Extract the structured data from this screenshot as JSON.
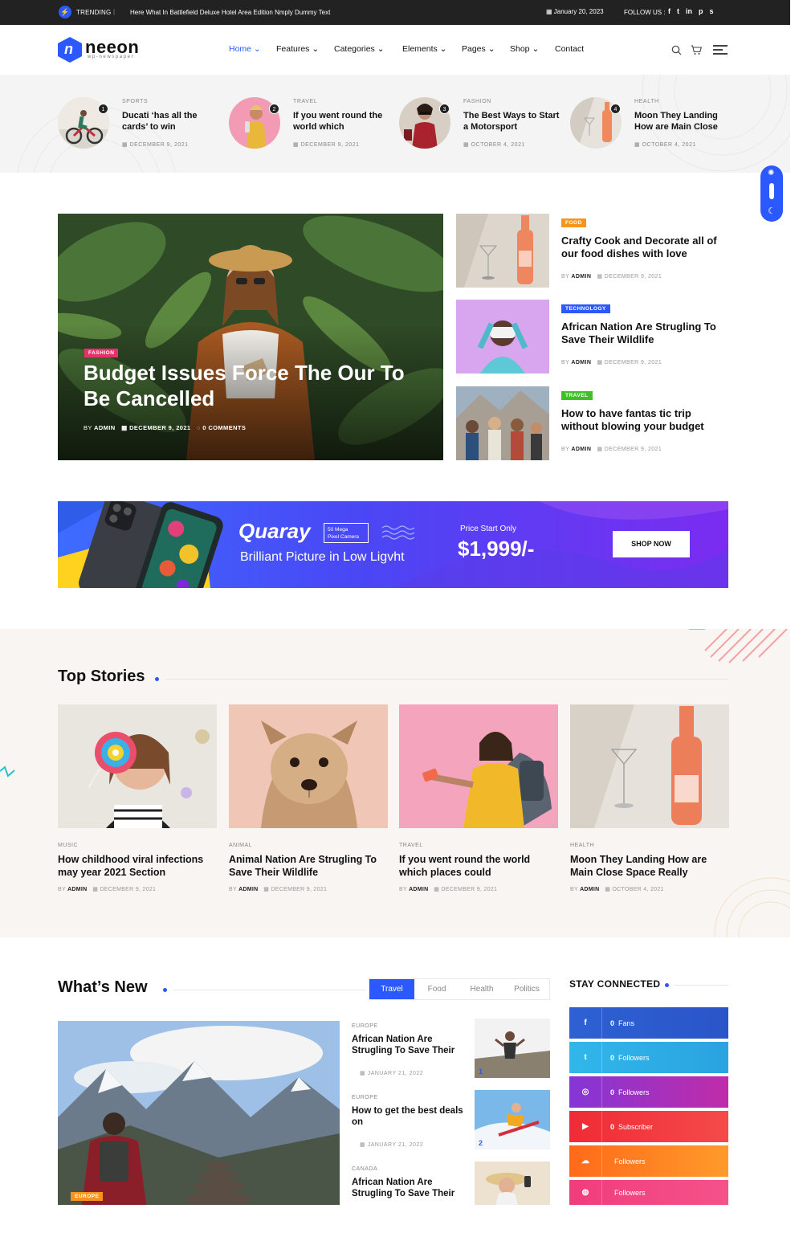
{
  "topbar": {
    "trending_label": "TRENDING",
    "separator": "|",
    "ticker_text": "Here What In Battlefield Deluxe Hotel Area Edition Nmply Dummy Text",
    "date": "January 20, 2023",
    "follow_label": "FOLLOW US :",
    "social_icons": [
      "facebook-icon",
      "twitter-icon",
      "linkedin-icon",
      "pinterest-icon",
      "skype-icon"
    ]
  },
  "brand": {
    "name": "neeon",
    "tagline": "wp-newspaper",
    "accent": "#2b59ff"
  },
  "nav": {
    "items": [
      {
        "label": "Home ⌄"
      },
      {
        "label": "Features ⌄"
      },
      {
        "label": "Categories ⌄"
      },
      {
        "label": "Elements ⌄"
      },
      {
        "label": "Pages ⌄"
      },
      {
        "label": "Shop ⌄"
      },
      {
        "label": "Contact"
      }
    ]
  },
  "trending": [
    {
      "num": "1",
      "category": "SPORTS",
      "title": "Ducati ‘has all the cards’ to win",
      "date": "DECEMBER 9, 2021"
    },
    {
      "num": "2",
      "category": "TRAVEL",
      "title": "If you went round the world which",
      "date": "DECEMBER 9, 2021"
    },
    {
      "num": "3",
      "category": "FASHION",
      "title": "The Best Ways to Start a Motorsport",
      "date": "OCTOBER 4, 2021"
    },
    {
      "num": "4",
      "category": "HEALTH",
      "title": "Moon They Landing How are Main Close",
      "date": "OCTOBER 4, 2021"
    }
  ],
  "hero": {
    "category": "FASHION",
    "title": "Budget Issues Force The Our To Be Cancelled",
    "by": "BY",
    "author": "ADMIN",
    "date": "DECEMBER 9, 2021",
    "comments": "0 COMMENTS"
  },
  "side_posts": [
    {
      "category": "FOOD",
      "color": "#f7941d",
      "title": "Crafty Cook and Decorate all of our food dishes with love",
      "by": "BY",
      "author": "ADMIN",
      "date": "DECEMBER 9, 2021"
    },
    {
      "category": "TECHNOLOGY",
      "color": "#2b59ff",
      "title": "African Nation Are Strugling To Save Their Wildlife",
      "by": "BY",
      "author": "ADMIN",
      "date": "DECEMBER 9, 2021"
    },
    {
      "category": "TRAVEL",
      "color": "#3ec126",
      "title": "How to have fantas tic trip without blowing your budget",
      "by": "BY",
      "author": "ADMIN",
      "date": "DECEMBER 9, 2021"
    }
  ],
  "banner": {
    "brand": "Quaray",
    "badge_line1": "50 Mega",
    "badge_line2": "Pixel Camera",
    "subtitle": "Brilliant Picture in Low Ligvht",
    "price_label": "Price Start Only",
    "price": "$1,999/-",
    "cta": "SHOP NOW"
  },
  "top_stories": {
    "heading": "Top Stories",
    "items": [
      {
        "category": "MUSIC",
        "title": "How childhood viral infections may year 2021 Section",
        "by": "BY",
        "author": "ADMIN",
        "date": "DECEMBER 9, 2021"
      },
      {
        "category": "ANIMAL",
        "title": "Animal Nation Are Strugling To Save Their Wildlife",
        "by": "BY",
        "author": "ADMIN",
        "date": "DECEMBER 9, 2021"
      },
      {
        "category": "TRAVEL",
        "title": "If you went round the world which places could",
        "by": "BY",
        "author": "ADMIN",
        "date": "DECEMBER 9, 2021"
      },
      {
        "category": "HEALTH",
        "title": "Moon They Landing How are Main Close Space Really",
        "by": "BY",
        "author": "ADMIN",
        "date": "OCTOBER 4, 2021"
      }
    ]
  },
  "whats_new": {
    "heading": "What’s New",
    "tabs": [
      "Travel",
      "Food",
      "Health",
      "Politics"
    ],
    "active_tab": "Travel",
    "featured_category": "EUROPE",
    "items": [
      {
        "category": "EUROPE",
        "title": "African Nation Are Strugling To Save Their",
        "date": "JANUARY 21, 2022",
        "num": "1"
      },
      {
        "category": "EUROPE",
        "title": "How to get the best deals on",
        "date": "JANUARY 21, 2022",
        "num": "2"
      },
      {
        "category": "CANADA",
        "title": "African Nation Are Strugling To Save Their",
        "date": "",
        "num": ""
      }
    ]
  },
  "stay_connected": {
    "heading": "STAY CONNECTED",
    "items": [
      {
        "icon": "facebook-icon",
        "glyph": "f",
        "count": "0",
        "label": "Fans",
        "color": "#2d61d3"
      },
      {
        "icon": "twitter-icon",
        "glyph": "t",
        "count": "0",
        "label": "Followers",
        "color": "#31b7ea"
      },
      {
        "icon": "instagram-icon",
        "glyph": "◎",
        "count": "0",
        "label": "Followers",
        "color": "#9b30c9"
      },
      {
        "icon": "youtube-icon",
        "glyph": "▶",
        "count": "0",
        "label": "Subscriber",
        "color": "#ef2b36"
      },
      {
        "icon": "soundcloud-icon",
        "glyph": "☁",
        "count": "",
        "label": "Followers",
        "color": "#ff7a1a"
      },
      {
        "icon": "dribbble-icon",
        "glyph": "◍",
        "count": "",
        "label": "Followers",
        "color": "#f03d7b"
      }
    ]
  }
}
